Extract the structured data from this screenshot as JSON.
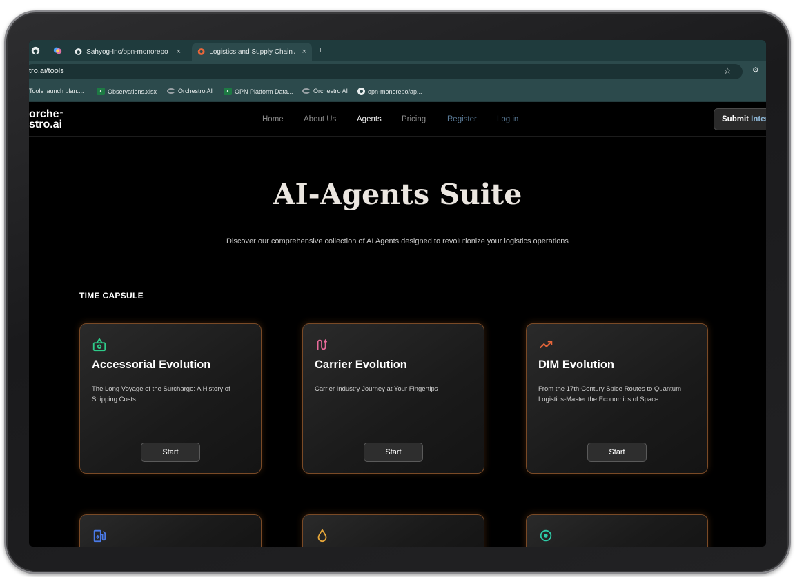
{
  "browser": {
    "tabs": [
      {
        "title": "Sahyog-Inc/opn-monorepo at",
        "active": false
      },
      {
        "title": "Logistics and Supply Chain AI",
        "active": true
      }
    ],
    "new_tab": "+",
    "close": "×",
    "url": "tro.ai/tools",
    "bookmarks": [
      {
        "label": "Tools launch plan....",
        "icon": "document-icon"
      },
      {
        "label": "Observations.xlsx",
        "icon": "excel-icon"
      },
      {
        "label": "Orchestro AI",
        "icon": "orchestro-icon"
      },
      {
        "label": "OPN Platform Data...",
        "icon": "excel-icon"
      },
      {
        "label": "Orchestro AI",
        "icon": "orchestro-icon"
      },
      {
        "label": "opn-monorepo/ap...",
        "icon": "github-icon"
      }
    ]
  },
  "site": {
    "logo": {
      "line1": "orche",
      "tm": "™",
      "line2": "stro.ai"
    },
    "nav": [
      "Home",
      "About Us",
      "Agents",
      "Pricing",
      "Register",
      "Log in"
    ],
    "active_nav": "Agents",
    "submit": {
      "part1": "Submit ",
      "part2": "Inter"
    }
  },
  "hero": {
    "title": "AI-Agents Suite",
    "subtitle": "Discover our comprehensive collection of AI Agents designed to revolutionize your logistics operations"
  },
  "section_title": "TIME CAPSULE",
  "cards": [
    {
      "title": "Accessorial Evolution",
      "desc": "The Long Voyage of the Surcharge: A History of Shipping Costs",
      "button": "Start",
      "icon": "money-icon",
      "icon_color": "#2ecc8a"
    },
    {
      "title": "Carrier Evolution",
      "desc": "Carrier Industry Journey at Your Fingertips",
      "button": "Start",
      "icon": "route-icon",
      "icon_color": "#e86a9a"
    },
    {
      "title": "DIM Evolution",
      "desc": "From the 17th-Century Spice Routes to Quantum Logistics-Master the Economics of Space",
      "button": "Start",
      "icon": "trending-up-icon",
      "icon_color": "#e8663a"
    }
  ],
  "more_cards_icons": [
    {
      "icon": "fuel-icon",
      "color": "#4a7ae8"
    },
    {
      "icon": "drop-icon",
      "color": "#e8a83a"
    },
    {
      "icon": "target-icon",
      "color": "#2ecca8"
    }
  ]
}
